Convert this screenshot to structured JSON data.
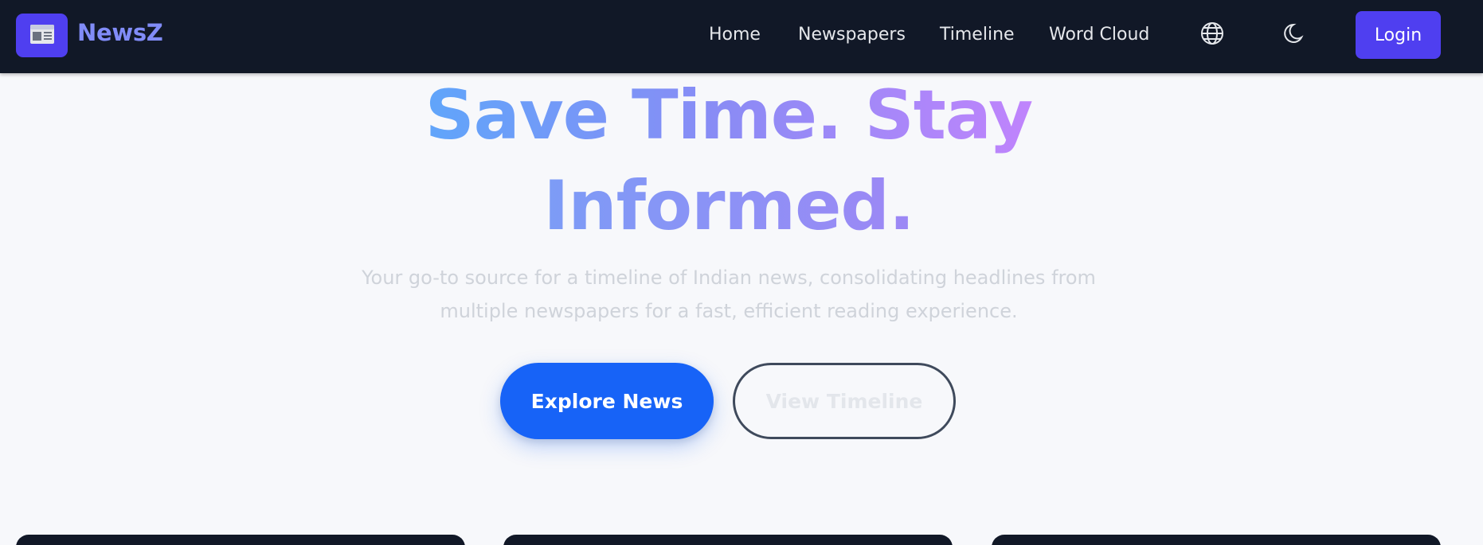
{
  "brand": {
    "name": "NewsZ",
    "logo_icon": "newspaper-icon",
    "accent": "#4f3ff0"
  },
  "nav": {
    "links": [
      {
        "label": "Home"
      },
      {
        "label": "Newspapers"
      },
      {
        "label": "Timeline"
      },
      {
        "label": "Word Cloud"
      }
    ],
    "language_icon": "globe-icon",
    "theme_icon": "moon-icon",
    "login_label": "Login"
  },
  "hero": {
    "title_line1_part1": "Save Time.",
    "title_line1_part2": "Stay",
    "title_line2": "Informed.",
    "subtitle_line1": "Your go-to source for a timeline of Indian news, consolidating headlines from",
    "subtitle_line2": "multiple newspapers for a fast, efficient reading experience.",
    "primary_button": "Explore News",
    "secondary_button": "View Timeline"
  },
  "colors": {
    "navbar_bg": "#111827",
    "primary_button": "#1763f7",
    "page_bg": "#f7f8fb"
  }
}
